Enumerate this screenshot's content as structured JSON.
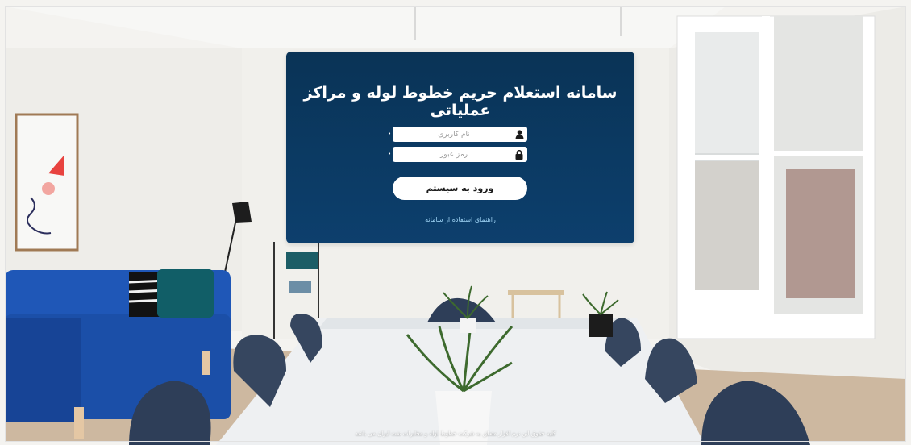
{
  "login": {
    "title": "سامانه استعلام حریم خطوط لوله و مراکز عملیاتی",
    "username_placeholder": "نام کاربری",
    "password_placeholder": "رمز عبور",
    "required_mark": "•",
    "submit_label": "ورود به سیستم",
    "guide_link": "راهنمای استفاده از سامانه"
  },
  "footer": {
    "copyright": "کلیه حقوق این نرم افزار متعلق به شرکت خطوط لوله و مخابرات نفت ایران می باشد"
  },
  "icons": {
    "username": "user-icon",
    "password": "lock-icon"
  },
  "colors": {
    "card_bg": "#0b3a63",
    "link": "#9ed3f4",
    "sofa": "#1f57b7"
  }
}
